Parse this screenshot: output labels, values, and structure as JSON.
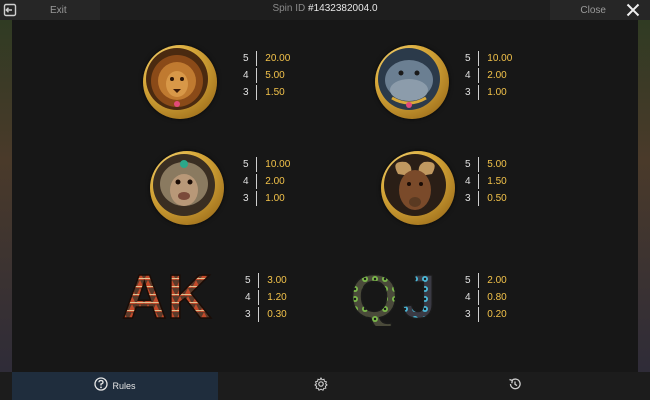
{
  "header": {
    "exit_label": "Exit",
    "spin_label": "Spin ID",
    "spin_value": "#1432382004.0",
    "close_label": "Close"
  },
  "paytable": [
    {
      "symbol": "lion-symbol",
      "pays": [
        {
          "count": "5",
          "value": "20.00"
        },
        {
          "count": "4",
          "value": "5.00"
        },
        {
          "count": "3",
          "value": "1.50"
        }
      ]
    },
    {
      "symbol": "hippo-symbol",
      "pays": [
        {
          "count": "5",
          "value": "10.00"
        },
        {
          "count": "4",
          "value": "2.00"
        },
        {
          "count": "3",
          "value": "1.00"
        }
      ]
    },
    {
      "symbol": "baboon-symbol",
      "pays": [
        {
          "count": "5",
          "value": "10.00"
        },
        {
          "count": "4",
          "value": "2.00"
        },
        {
          "count": "3",
          "value": "1.00"
        }
      ]
    },
    {
      "symbol": "goat-symbol",
      "pays": [
        {
          "count": "5",
          "value": "5.00"
        },
        {
          "count": "4",
          "value": "1.50"
        },
        {
          "count": "3",
          "value": "0.50"
        }
      ]
    },
    {
      "symbol": "ak-letters-symbol",
      "letters": "AK",
      "pays": [
        {
          "count": "5",
          "value": "3.00"
        },
        {
          "count": "4",
          "value": "1.20"
        },
        {
          "count": "3",
          "value": "0.30"
        }
      ]
    },
    {
      "symbol": "qj-letters-symbol",
      "letters": "QJ",
      "pays": [
        {
          "count": "5",
          "value": "2.00"
        },
        {
          "count": "4",
          "value": "0.80"
        },
        {
          "count": "3",
          "value": "0.20"
        }
      ]
    }
  ],
  "footer": {
    "tabs": [
      {
        "label": "Rules",
        "icon": "help-icon",
        "active": true
      },
      {
        "label": "",
        "icon": "settings-icon",
        "active": false
      },
      {
        "label": "",
        "icon": "history-icon",
        "active": false
      }
    ]
  },
  "colors": {
    "payout": "#f2c24a",
    "active_tab": "#1f2d3d",
    "medal_gold": "#d8a93a"
  }
}
